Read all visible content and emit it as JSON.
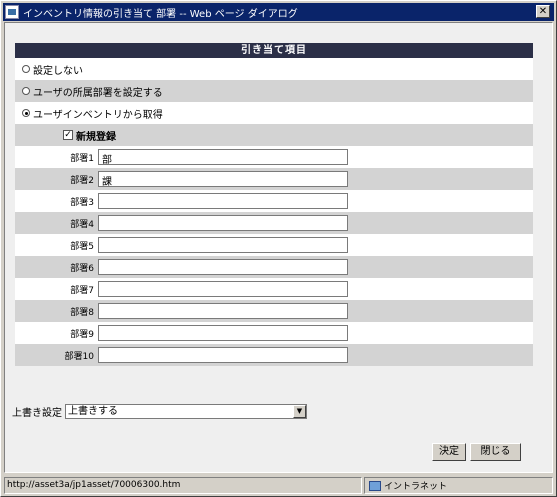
{
  "window": {
    "title": "インベントリ情報の引き当て 部署 -- Web ページ ダイアログ",
    "close_glyph": "✕"
  },
  "panel": {
    "header": "引き当て項目",
    "options": [
      {
        "label": "設定しない",
        "selected": false
      },
      {
        "label": "ユーザの所属部署を設定する",
        "selected": false
      },
      {
        "label": "ユーザインベントリから取得",
        "selected": true
      }
    ],
    "new_register": {
      "label": "新規登録",
      "checked": true,
      "check_glyph": "✓"
    },
    "departments": [
      {
        "label": "部署1",
        "value": "部"
      },
      {
        "label": "部署2",
        "value": "課"
      },
      {
        "label": "部署3",
        "value": ""
      },
      {
        "label": "部署4",
        "value": ""
      },
      {
        "label": "部署5",
        "value": ""
      },
      {
        "label": "部署6",
        "value": ""
      },
      {
        "label": "部署7",
        "value": ""
      },
      {
        "label": "部署8",
        "value": ""
      },
      {
        "label": "部署9",
        "value": ""
      },
      {
        "label": "部署10",
        "value": ""
      }
    ]
  },
  "overwrite": {
    "label": "上書き設定",
    "selected": "上書きする",
    "arrow_glyph": "▼"
  },
  "buttons": {
    "decide": "決定",
    "close": "閉じる"
  },
  "status": {
    "url": "http://asset3a/jp1asset/70006300.htm",
    "zone": "イントラネット"
  }
}
